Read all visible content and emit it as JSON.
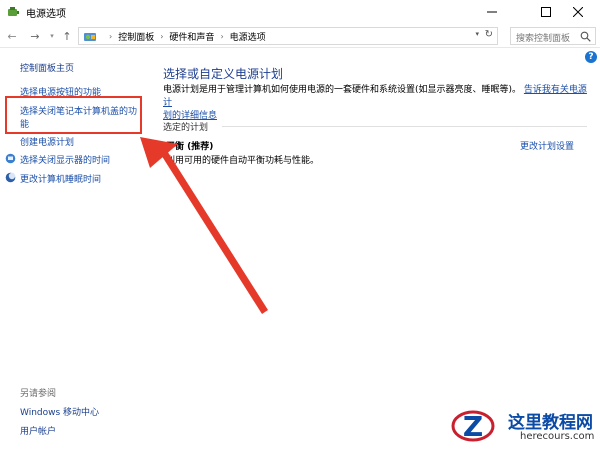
{
  "window": {
    "title": "电源选项"
  },
  "address": {
    "crumbs": [
      "控制面板",
      "硬件和声音",
      "电源选项"
    ],
    "search_placeholder": "搜索控制面板"
  },
  "leftnav": {
    "home": "控制面板主页",
    "item1": "选择电源按钮的功能",
    "item2_line1": "选择关闭笔记本计算机盖的功",
    "item2_line2": "能",
    "item3": "创建电源计划",
    "item4": "选择关闭显示器的时间",
    "item5": "更改计算机睡眠时间",
    "see_also": "另请参阅",
    "see1": "Windows 移动中心",
    "see2": "用户帐户"
  },
  "main": {
    "title": "选择或自定义电源计划",
    "desc_line1": "电源计划是用于管理计算机如何使用电源的一套硬件和系统设置(如显示器亮度、睡眠等)。",
    "desc_link_part1": "告诉我有关电源计",
    "desc_link_part2": "划的详细信息",
    "section": "选定的计划",
    "plan_name": "平衡 (推荐)",
    "plan_desc": "利用可用的硬件自动平衡功耗与性能。",
    "plan_link": "更改计划设置"
  },
  "watermark": {
    "title": "这里教程网",
    "url": "herecours.com"
  },
  "colors": {
    "link": "#1b4fa8",
    "title": "#1e3e8e",
    "highlight": "#e53a2a"
  }
}
